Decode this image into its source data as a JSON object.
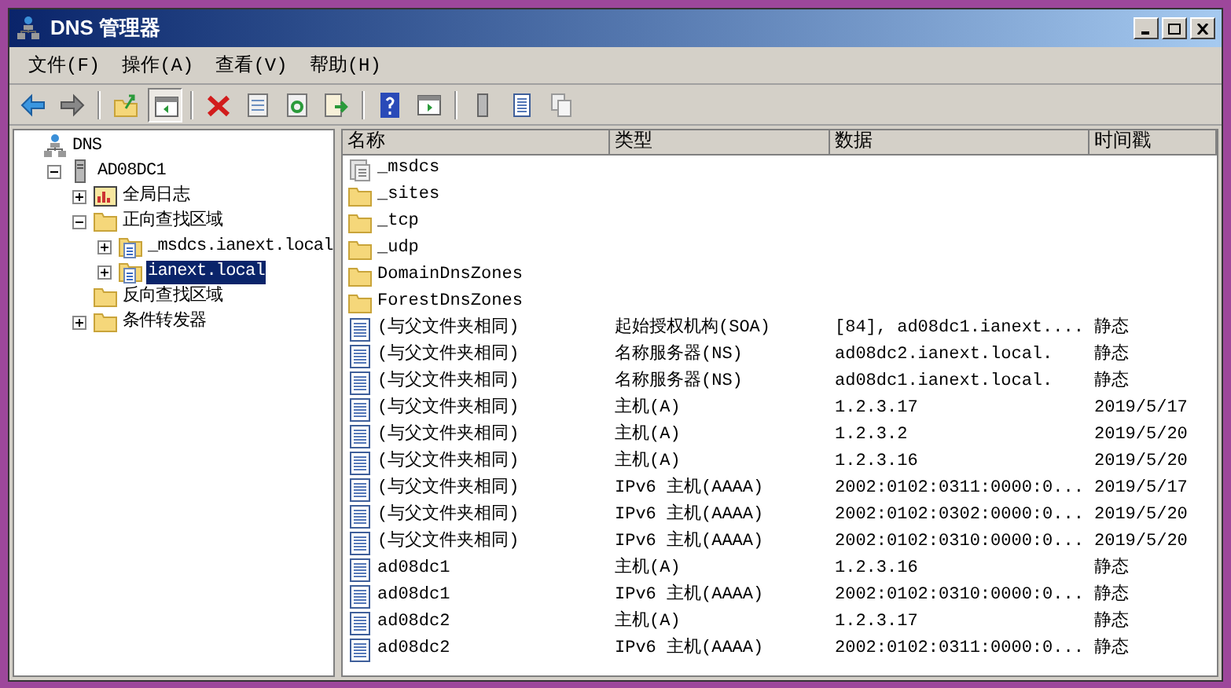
{
  "window": {
    "title": "DNS 管理器"
  },
  "menu": [
    "文件(F)",
    "操作(A)",
    "查看(V)",
    "帮助(H)"
  ],
  "toolbar": [
    [
      {
        "kind": "back",
        "pressed": false
      },
      {
        "kind": "forward",
        "pressed": false
      }
    ],
    [
      {
        "kind": "up",
        "pressed": false
      },
      {
        "kind": "tree",
        "pressed": true
      }
    ],
    [
      {
        "kind": "delete",
        "pressed": false
      },
      {
        "kind": "properties",
        "pressed": false
      },
      {
        "kind": "refresh",
        "pressed": false
      },
      {
        "kind": "export",
        "pressed": false
      }
    ],
    [
      {
        "kind": "help",
        "pressed": false
      },
      {
        "kind": "pane",
        "pressed": false
      }
    ],
    [
      {
        "kind": "server",
        "pressed": false
      },
      {
        "kind": "list",
        "pressed": false
      },
      {
        "kind": "copy",
        "pressed": false
      }
    ]
  ],
  "tree": [
    {
      "label": "DNS",
      "kind": "dns",
      "selected": false,
      "children": [
        {
          "label": "AD08DC1",
          "kind": "server",
          "selected": false,
          "expanded": true,
          "children": [
            {
              "label": "全局日志",
              "kind": "log",
              "selected": false,
              "expanded": false
            },
            {
              "label": "正向查找区域",
              "kind": "folder",
              "selected": false,
              "expanded": true,
              "children": [
                {
                  "label": "_msdcs.ianext.local",
                  "kind": "zone",
                  "selected": false,
                  "expanded": false
                },
                {
                  "label": "ianext.local",
                  "kind": "zone",
                  "selected": true,
                  "expanded": false
                }
              ]
            },
            {
              "label": "反向查找区域",
              "kind": "folder",
              "selected": false
            },
            {
              "label": "条件转发器",
              "kind": "folder",
              "selected": false,
              "expanded": false
            }
          ]
        }
      ]
    }
  ],
  "table": {
    "columns": [
      "名称",
      "类型",
      "数据",
      "时间戳"
    ],
    "rows": [
      {
        "kind": "zone",
        "name": "_msdcs"
      },
      {
        "kind": "folder",
        "name": "_sites"
      },
      {
        "kind": "folder",
        "name": "_tcp"
      },
      {
        "kind": "folder",
        "name": "_udp"
      },
      {
        "kind": "folder",
        "name": "DomainDnsZones"
      },
      {
        "kind": "folder",
        "name": "ForestDnsZones"
      },
      {
        "kind": "record",
        "name": "(与父文件夹相同)",
        "type": "起始授权机构(SOA)",
        "data": "[84], ad08dc1.ianext....",
        "timestamp": "静态"
      },
      {
        "kind": "record",
        "name": "(与父文件夹相同)",
        "type": "名称服务器(NS)",
        "data": "ad08dc2.ianext.local.",
        "timestamp": "静态"
      },
      {
        "kind": "record",
        "name": "(与父文件夹相同)",
        "type": "名称服务器(NS)",
        "data": "ad08dc1.ianext.local.",
        "timestamp": "静态"
      },
      {
        "kind": "record",
        "name": "(与父文件夹相同)",
        "type": "主机(A)",
        "data": "1.2.3.17",
        "timestamp": "2019/5/17"
      },
      {
        "kind": "record",
        "name": "(与父文件夹相同)",
        "type": "主机(A)",
        "data": "1.2.3.2",
        "timestamp": "2019/5/20"
      },
      {
        "kind": "record",
        "name": "(与父文件夹相同)",
        "type": "主机(A)",
        "data": "1.2.3.16",
        "timestamp": "2019/5/20"
      },
      {
        "kind": "record",
        "name": "(与父文件夹相同)",
        "type": "IPv6 主机(AAAA)",
        "data": "2002:0102:0311:0000:0...",
        "timestamp": "2019/5/17"
      },
      {
        "kind": "record",
        "name": "(与父文件夹相同)",
        "type": "IPv6 主机(AAAA)",
        "data": "2002:0102:0302:0000:0...",
        "timestamp": "2019/5/20"
      },
      {
        "kind": "record",
        "name": "(与父文件夹相同)",
        "type": "IPv6 主机(AAAA)",
        "data": "2002:0102:0310:0000:0...",
        "timestamp": "2019/5/20"
      },
      {
        "kind": "record",
        "name": "ad08dc1",
        "type": "主机(A)",
        "data": "1.2.3.16",
        "timestamp": "静态"
      },
      {
        "kind": "record",
        "name": "ad08dc1",
        "type": "IPv6 主机(AAAA)",
        "data": "2002:0102:0310:0000:0...",
        "timestamp": "静态"
      },
      {
        "kind": "record",
        "name": "ad08dc2",
        "type": "主机(A)",
        "data": "1.2.3.17",
        "timestamp": "静态"
      },
      {
        "kind": "record",
        "name": "ad08dc2",
        "type": "IPv6 主机(AAAA)",
        "data": "2002:0102:0311:0000:0...",
        "timestamp": "静态"
      }
    ]
  }
}
